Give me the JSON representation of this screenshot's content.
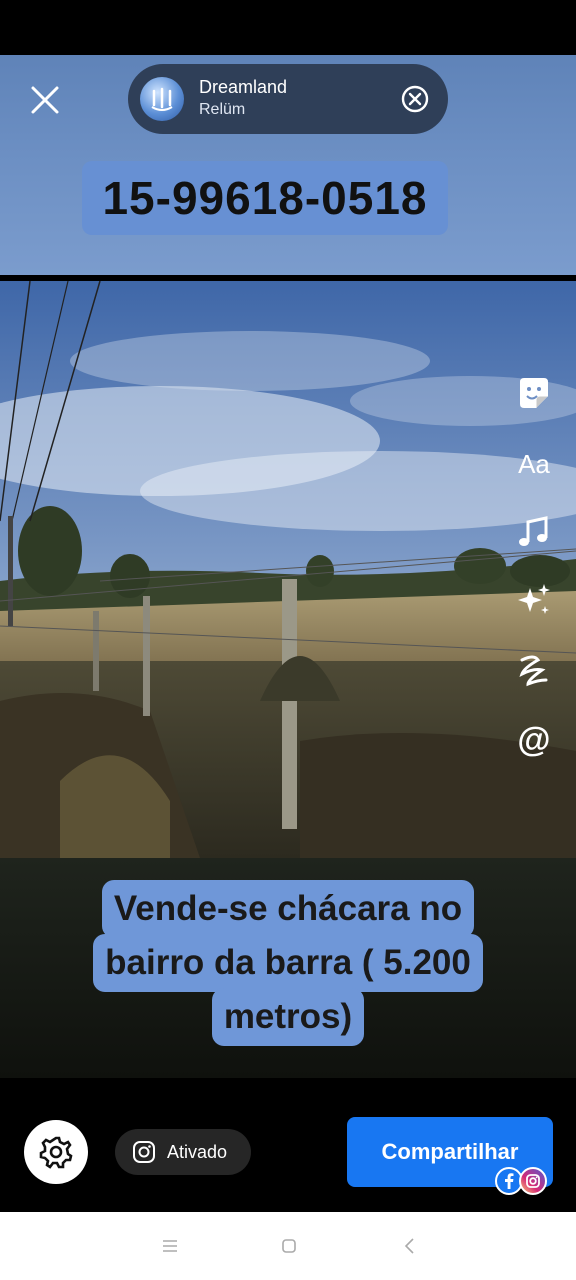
{
  "music": {
    "title": "Dreamland",
    "artist": "Relüm"
  },
  "phone_sticker": "15-99618-0518",
  "caption_lines": [
    "Vende-se chácara no",
    "bairro da barra ( 5.200",
    "metros)"
  ],
  "editor_tools": [
    "sticker-icon",
    "text-icon",
    "music-icon",
    "effects-icon",
    "draw-icon",
    "mention-icon"
  ],
  "text_tool_label": "Aa",
  "mention_label": "@",
  "instagram_toggle": {
    "label": "Ativado",
    "icon": "instagram-icon"
  },
  "share_button": {
    "label": "Compartilhar"
  },
  "colors": {
    "accent": "#1877f2",
    "sticker_bg": "#6f97d8",
    "top_panel": "#6c8fc3"
  },
  "nav": [
    "menu-icon",
    "home-icon",
    "back-icon"
  ]
}
